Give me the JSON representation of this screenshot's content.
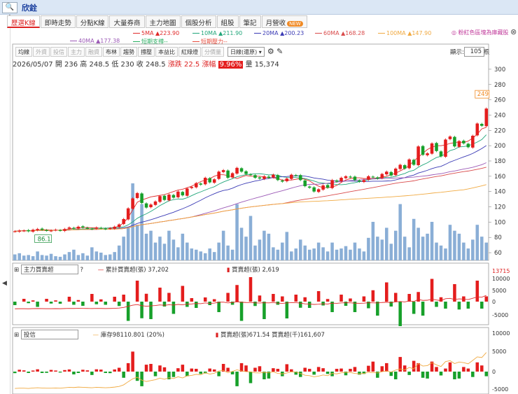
{
  "header": {
    "logo_label": "🔍+",
    "stock_name": "欣銓"
  },
  "tabs": [
    {
      "label": "歷選K線",
      "active": true
    },
    {
      "label": "即時走勢"
    },
    {
      "label": "分點K線"
    },
    {
      "label": "大量券商"
    },
    {
      "label": "主力地圖"
    },
    {
      "label": "個股分析"
    },
    {
      "label": "組股"
    },
    {
      "label": "筆記"
    },
    {
      "label": "月營收",
      "badge": "NEW"
    }
  ],
  "promo": "粉紅色區塊為庫藏股",
  "close_label": "⊗",
  "ma_legend": [
    {
      "label": "5MA ▲223.90",
      "color": "#e02a2a"
    },
    {
      "label": "10MA ▲211.90",
      "color": "#21a67a"
    },
    {
      "label": "20MA ▲200.23",
      "color": "#3a3ab5"
    },
    {
      "label": "60MA ▲168.28",
      "color": "#d94a4a"
    },
    {
      "label": "100MA ▲147.90",
      "color": "#f0a940"
    },
    {
      "label": "40MA ▲177.38",
      "color": "#9b59b6"
    },
    {
      "label": "短期支撐--",
      "color": "#27ae60"
    },
    {
      "label": "短期壓力--",
      "color": "#e74c3c"
    }
  ],
  "toolbar": {
    "buttons": [
      {
        "label": "均線",
        "dim": false
      },
      {
        "label": "外資",
        "dim": true
      },
      {
        "label": "投信",
        "dim": true
      },
      {
        "label": "主力",
        "dim": true
      },
      {
        "label": "融資",
        "dim": true
      },
      {
        "label": "布林",
        "dim": false
      },
      {
        "label": "趨勢",
        "dim": false
      },
      {
        "label": "撐壓",
        "dim": false
      },
      {
        "label": "本益比",
        "dim": false
      },
      {
        "label": "紅綠燈",
        "dim": false
      },
      {
        "label": "分價量",
        "dim": true
      }
    ],
    "period_select": "日線(還原)",
    "zoom_label": "顯示:",
    "zoom_value": "105",
    "zoom_unit": "根"
  },
  "quote": {
    "date": "2026/05/07",
    "open_label": "開",
    "open": "236",
    "high_label": "高",
    "high": "248.5",
    "low_label": "低",
    "low": "230",
    "close_label": "收",
    "close": "248.5",
    "change_label": "漲跌",
    "change": "22.5",
    "pct_label": "漲幅",
    "pct": "9.96%",
    "vol_label": "量",
    "vol": "15,374"
  },
  "panel2": {
    "select": "主力買賣超",
    "help": "?",
    "cum_label": "累計買賣超(張)",
    "cum_value": "37,202",
    "net_label": "買賣超(張)",
    "net_value": "2,619",
    "right_value": "13715"
  },
  "panel3": {
    "select": "投信",
    "inv_label": "庫存98110.801 (20%)",
    "net_label": "買賣超(張)671.54 買賣超(千)161,607"
  },
  "chart_data": {
    "type": "candlestick",
    "n": 105,
    "ylim": [
      50,
      310
    ],
    "yticks": [
      60,
      80,
      100,
      120,
      140,
      160,
      180,
      200,
      220,
      240,
      260,
      280,
      300
    ],
    "lastLabel": "249",
    "lowLabel": "86.1",
    "closes": [
      88,
      89,
      89,
      88,
      90,
      91,
      90,
      89,
      89,
      90,
      89,
      91,
      93,
      92,
      94,
      93,
      92,
      91,
      93,
      92,
      91,
      92,
      94,
      97,
      104,
      118,
      131,
      138,
      125,
      119,
      123,
      127,
      134,
      129,
      136,
      132,
      140,
      135,
      144,
      146,
      151,
      149,
      158,
      152,
      156,
      166,
      168,
      158,
      164,
      171,
      166,
      163,
      162,
      158,
      157,
      160,
      158,
      162,
      155,
      153,
      157,
      162,
      161,
      155,
      147,
      145,
      140,
      143,
      148,
      145,
      155,
      153,
      158,
      160,
      159,
      155,
      153,
      155,
      160,
      159,
      157,
      163,
      166,
      161,
      170,
      175,
      170,
      182,
      175,
      199,
      188,
      190,
      203,
      193,
      186,
      208,
      212,
      199,
      206,
      203,
      198,
      213,
      229,
      226,
      248.5
    ],
    "volumes": [
      10,
      12,
      8,
      9,
      7,
      15,
      9,
      8,
      11,
      7,
      6,
      10,
      14,
      18,
      9,
      12,
      8,
      22,
      15,
      13,
      9,
      10,
      14,
      25,
      40,
      55,
      130,
      60,
      95,
      45,
      50,
      30,
      40,
      28,
      50,
      35,
      22,
      45,
      30,
      20,
      18,
      15,
      12,
      20,
      14,
      30,
      50,
      25,
      18,
      95,
      55,
      40,
      75,
      25,
      35,
      50,
      45,
      22,
      18,
      30,
      48,
      15,
      20,
      35,
      25,
      18,
      20,
      30,
      22,
      15,
      30,
      18,
      20,
      24,
      18,
      30,
      20,
      15,
      38,
      65,
      40,
      35,
      55,
      28,
      50,
      95,
      40,
      22,
      70,
      55,
      40,
      45,
      65,
      30,
      25,
      20,
      60,
      50,
      45,
      30,
      20,
      35,
      60,
      40,
      30
    ],
    "ma5": [
      88,
      88.5,
      89,
      89,
      89,
      89.5,
      90,
      90,
      89.5,
      89.5,
      89.5,
      90,
      91,
      92,
      92.5,
      93,
      93,
      92.5,
      92.5,
      92,
      92,
      92.5,
      93,
      95,
      99,
      106,
      116,
      126,
      129,
      131,
      133,
      134,
      135,
      136,
      138,
      140,
      142,
      143,
      145,
      147,
      150,
      153,
      155,
      157,
      160,
      162,
      162,
      161,
      159,
      157,
      159,
      161,
      160,
      160,
      160,
      159,
      158,
      158,
      157,
      155,
      155,
      155,
      156,
      157,
      156,
      154,
      150,
      147,
      145,
      145,
      146,
      148,
      152,
      155,
      157,
      158,
      158,
      157,
      157,
      157,
      158,
      159,
      160,
      162,
      164,
      167,
      170,
      174,
      180,
      185,
      190,
      195,
      198,
      200,
      200,
      201,
      203,
      204,
      205,
      204,
      206,
      210,
      215,
      222,
      224
    ]
  }
}
